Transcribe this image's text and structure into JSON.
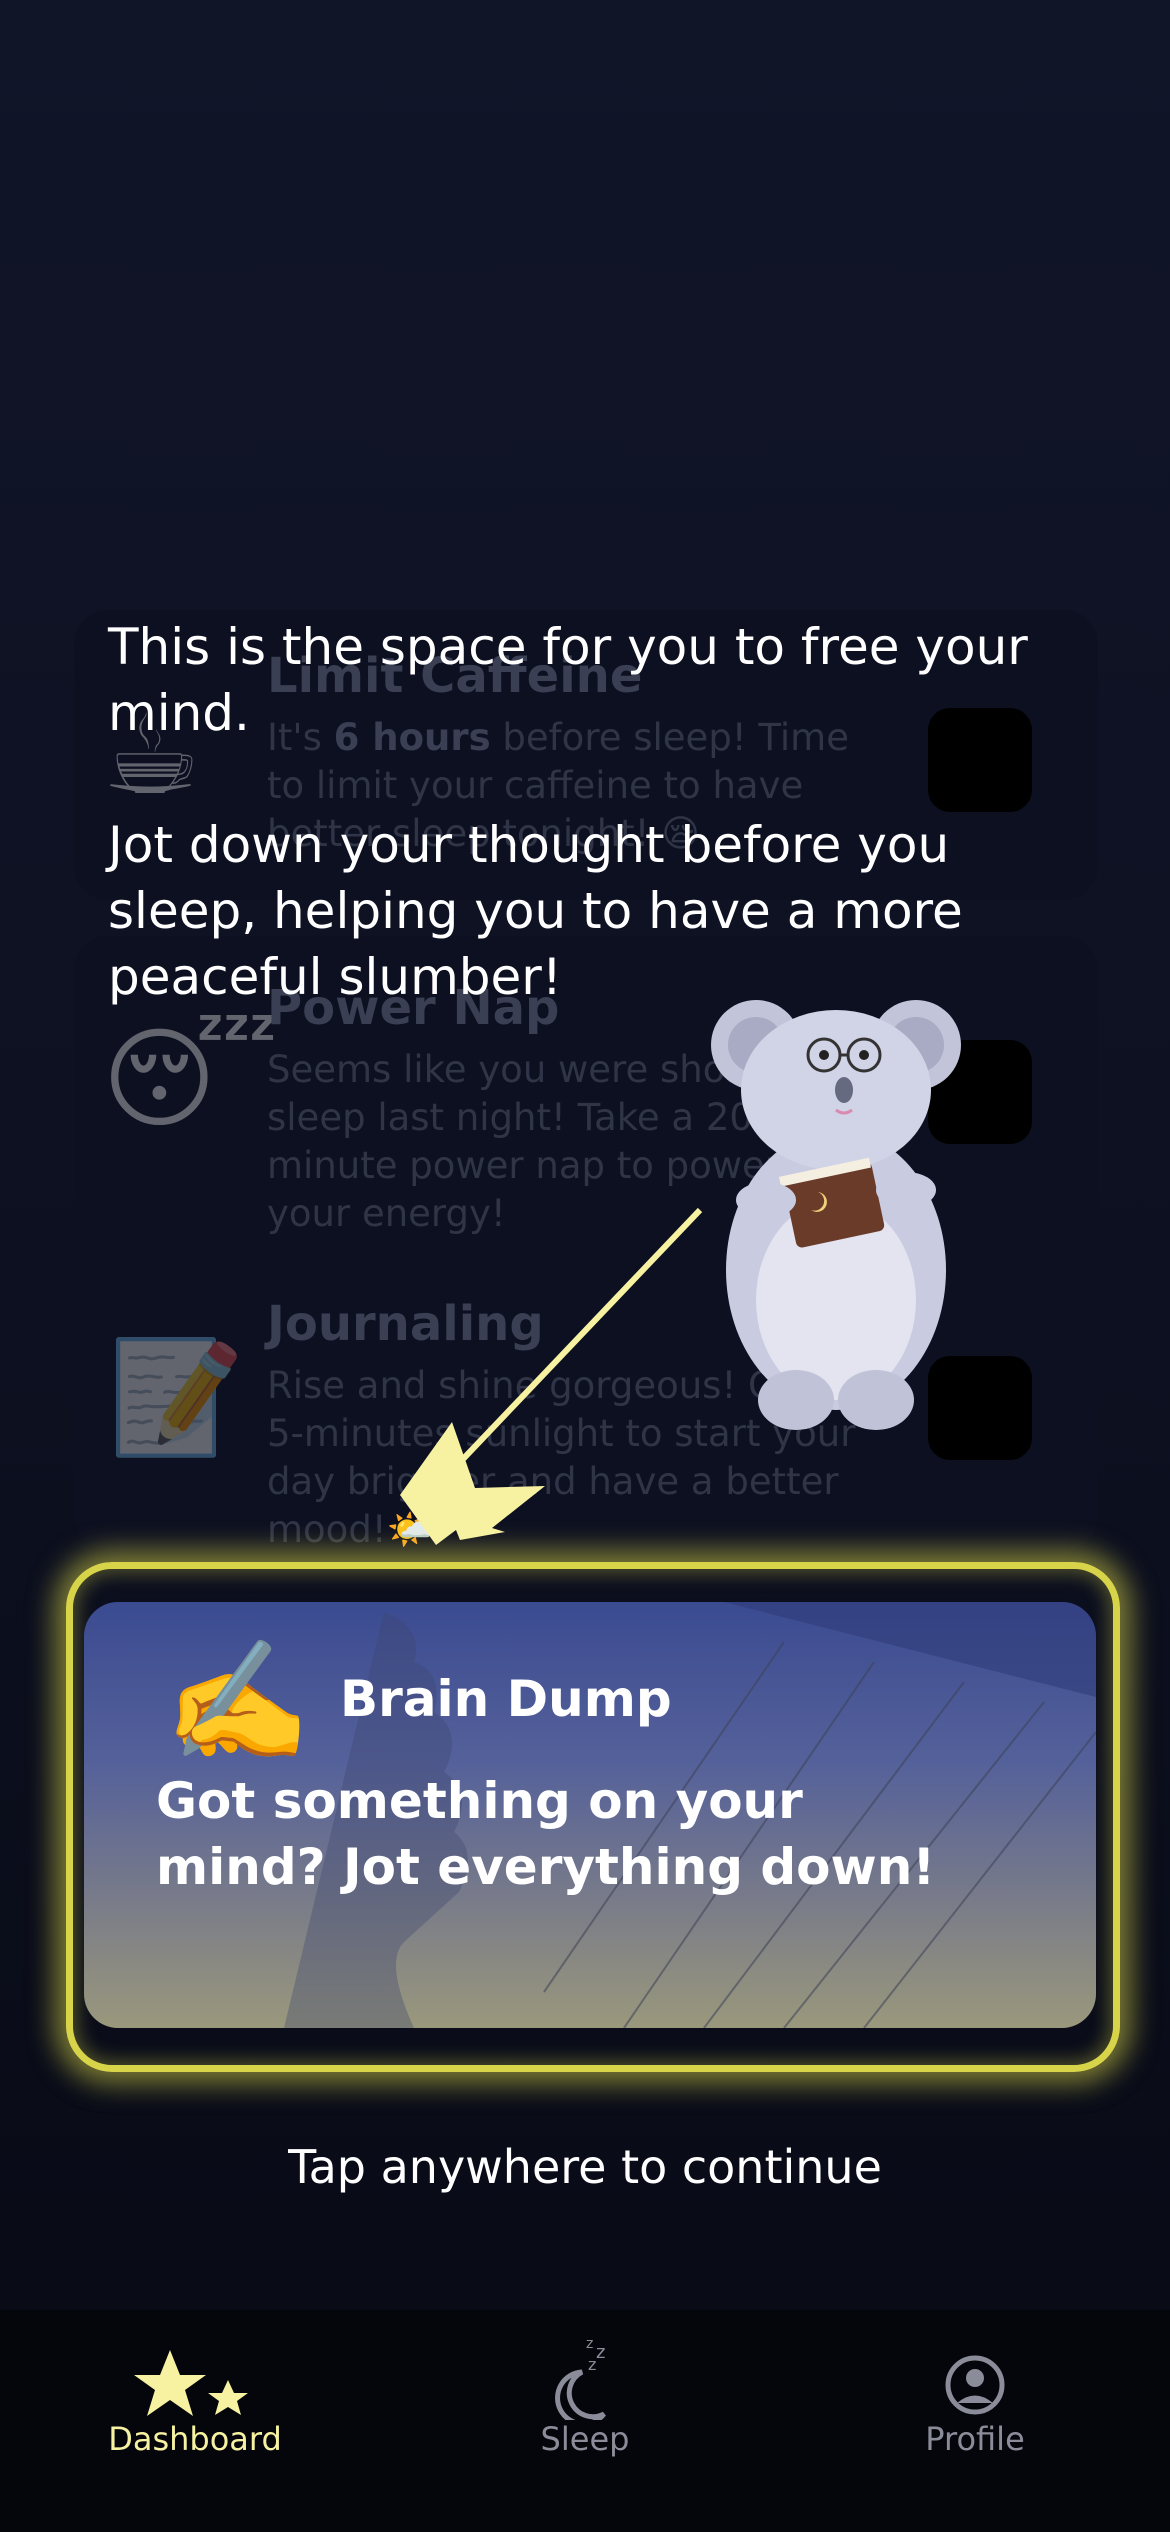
{
  "cards": [
    {
      "emoji": "☕",
      "title": "Limit Caffeine",
      "desc_prefix": "It's ",
      "desc_bold": "6 hours",
      "desc_rest": " before sleep! Time to limit your caffeine to have better sleep tonight! 😪"
    },
    {
      "emoji": "😴",
      "title": "Power Nap",
      "desc": "Seems like you were short of sleep last night! Take a 20-minute power nap to power up your energy!"
    },
    {
      "emoji": "📝",
      "title": "Journaling",
      "desc": "Rise and shine gorgeous! Get 5-minutes sunlight to start your day brighter and have a better mood!🌤️"
    }
  ],
  "intro": {
    "line1": "This is the space for you to free your mind.",
    "line2": "Jot down your thought before you sleep, helping you to have a more peaceful slumber!"
  },
  "brain_dump": {
    "icon": "✍️",
    "title": "Brain Dump",
    "desc": "Got something on your mind? Jot everything down!"
  },
  "continue_text": "Tap anywhere to continue",
  "tabs": [
    {
      "label": "Dashboard",
      "icon": "stars-icon",
      "active": true
    },
    {
      "label": "Sleep",
      "icon": "moon-zzz-icon",
      "active": false
    },
    {
      "label": "Profile",
      "icon": "user-circle-icon",
      "active": false
    }
  ],
  "colors": {
    "accent": "#f7f2a2",
    "highlight_glow": "#d8d44a",
    "inactive_tab": "#8a8d99"
  }
}
